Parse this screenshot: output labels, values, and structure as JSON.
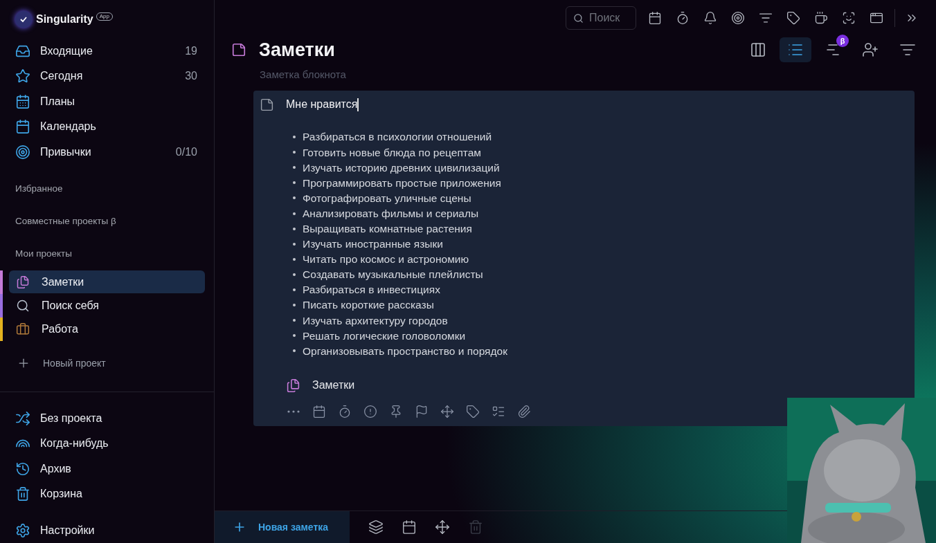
{
  "app": {
    "name": "Singularity",
    "badge": "App"
  },
  "nav": [
    {
      "label": "Входящие",
      "count": "19"
    },
    {
      "label": "Сегодня",
      "count": "30"
    },
    {
      "label": "Планы"
    },
    {
      "label": "Календарь"
    },
    {
      "label": "Привычки",
      "count": "0/10"
    }
  ],
  "sections": [
    "Избранное",
    "Совместные проекты β",
    "Мои проекты"
  ],
  "projects": [
    {
      "label": "Заметки",
      "selected": true,
      "color": "#c57ad8"
    },
    {
      "label": "Поиск себя",
      "selected": false,
      "color": "#9a6ee0"
    },
    {
      "label": "Работа",
      "selected": false,
      "color": "#e3b21f"
    }
  ],
  "new_project": "Новый проект",
  "bottom_nav": [
    {
      "label": "Без проекта"
    },
    {
      "label": "Когда-нибудь"
    },
    {
      "label": "Архив"
    },
    {
      "label": "Корзина"
    }
  ],
  "settings": "Настройки",
  "search": {
    "placeholder": "Поиск"
  },
  "header": {
    "title": "Заметки",
    "subtitle_placeholder": "Заметка блокнота"
  },
  "views": [
    {
      "selected": false
    },
    {
      "selected": true
    },
    {
      "selected": false,
      "badge": "β"
    },
    {
      "selected": false
    },
    {
      "selected": false
    }
  ],
  "note": {
    "title": "Мне нравится",
    "items": [
      "Разбираться в психологии отношений",
      "Готовить новые блюда по рецептам",
      "Изучать историю древних цивилизаций",
      "Программировать простые приложения",
      "Фотографировать уличные сцены",
      "Анализировать фильмы и сериалы",
      "Выращивать комнатные растения",
      "Изучать иностранные языки",
      "Читать про космос и астрономию",
      "Создавать музыкальные плейлисты",
      "Разбираться в инвестициях",
      "Писать короткие рассказы",
      "Изучать архитектуру городов",
      "Решать логические головоломки",
      "Организовывать пространство и порядок"
    ],
    "project": "Заметки"
  },
  "bottom_bar": {
    "new_note": "Новая заметка",
    "delete_disabled": true
  },
  "overlay": {
    "kind": "picture"
  }
}
